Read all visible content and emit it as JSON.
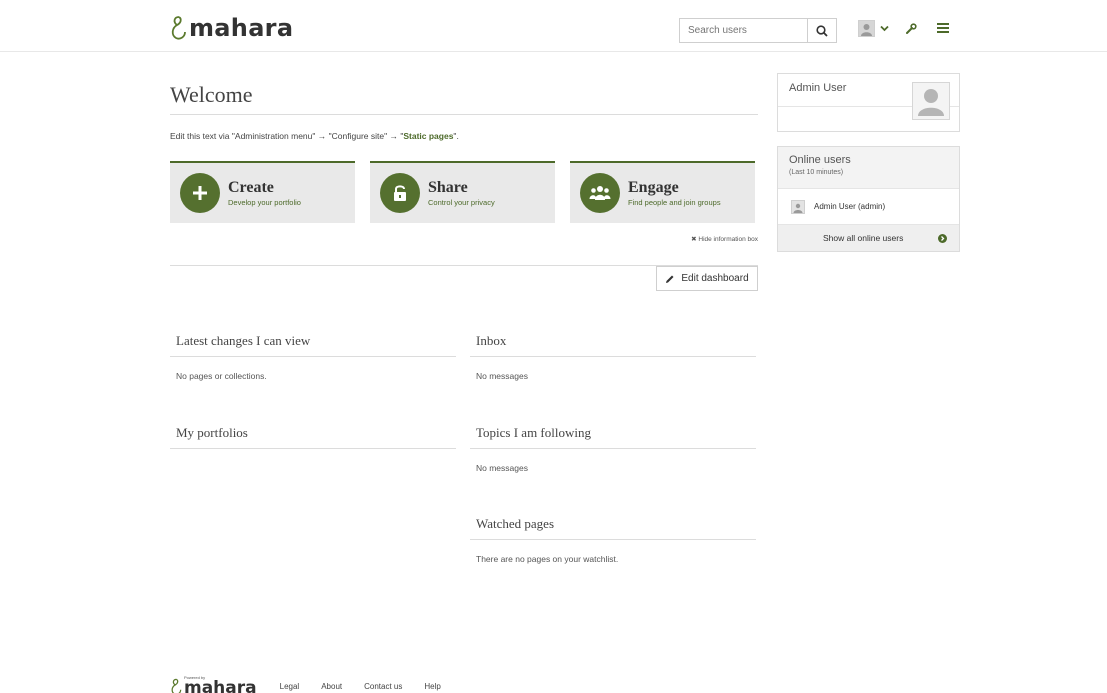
{
  "header": {
    "logo_text": "mahara",
    "search_placeholder": "Search users"
  },
  "main": {
    "welcome_title": "Welcome",
    "intro_prefix": "Edit this text via \"Administration menu\" → \"Configure site\" → \"",
    "intro_bold": "Static pages",
    "intro_suffix": "\".",
    "tiles": [
      {
        "title": "Create",
        "subtitle": "Develop your portfolio",
        "icon": "plus-icon"
      },
      {
        "title": "Share",
        "subtitle": "Control your privacy",
        "icon": "unlock-icon"
      },
      {
        "title": "Engage",
        "subtitle": "Find people and join groups",
        "icon": "users-icon"
      }
    ],
    "hide_info_label": "Hide information box",
    "edit_dashboard_label": "Edit dashboard"
  },
  "blocks": {
    "latest_changes": {
      "title": "Latest changes I can view",
      "body": "No pages or collections."
    },
    "inbox": {
      "title": "Inbox",
      "body": "No messages"
    },
    "my_portfolios": {
      "title": "My portfolios",
      "body": ""
    },
    "topics": {
      "title": "Topics I am following",
      "body": "No messages"
    },
    "watched": {
      "title": "Watched pages",
      "body": "There are no pages on your watchlist."
    }
  },
  "sidebar": {
    "admin_user_title": "Admin User",
    "online_title": "Online users",
    "online_subtitle": "(Last 10 minutes)",
    "online_users": [
      "Admin User (admin)"
    ],
    "show_all_label": "Show all online users"
  },
  "footer": {
    "powered_by": "Powered by",
    "logo_text": "mahara",
    "links": [
      "Legal",
      "About",
      "Contact us",
      "Help"
    ]
  },
  "colors": {
    "accent": "#4d6a2a",
    "tile_bg": "#e9e9e9",
    "icon_circle": "#55702f"
  }
}
